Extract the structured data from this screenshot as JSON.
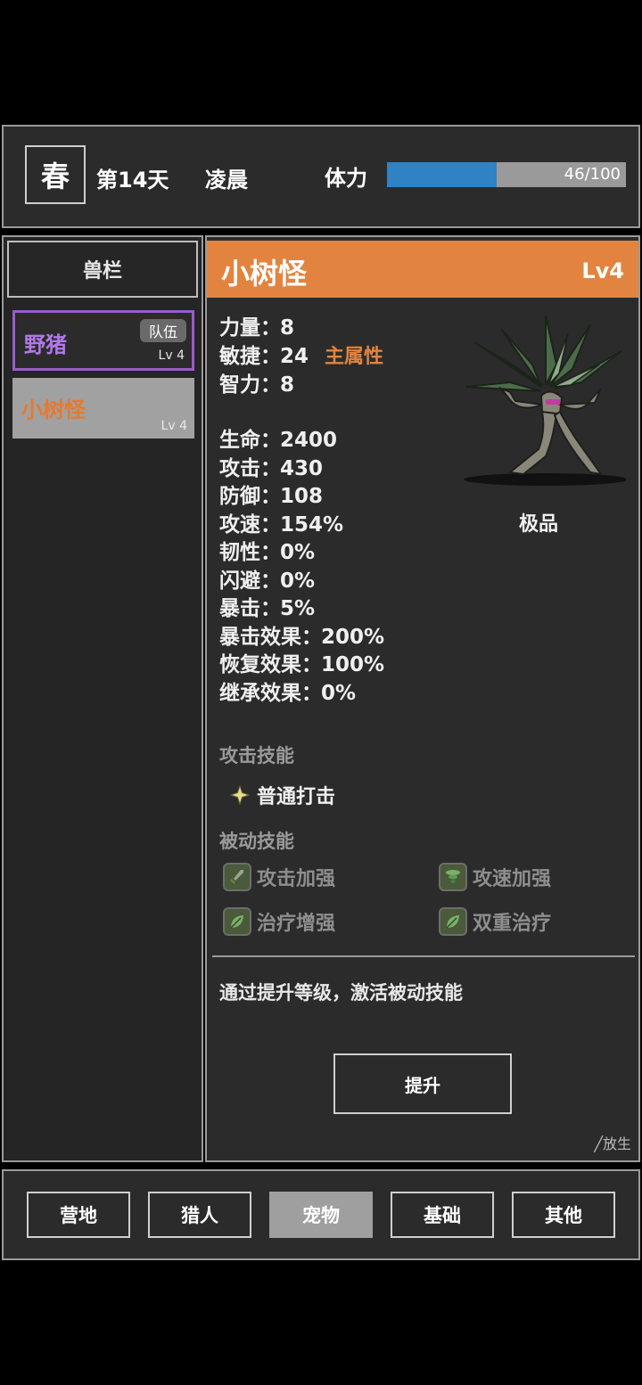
{
  "header": {
    "season": "春",
    "day": "第14天",
    "time_of_day": "凌晨",
    "stamina_label": "体力",
    "stamina_current": 46,
    "stamina_max": 100,
    "stamina_text": "46/100",
    "stamina_color": "#2f82c4"
  },
  "pet_list": {
    "title": "兽栏",
    "items": [
      {
        "name": "野猪",
        "level": "Lv 4",
        "badge": "队伍",
        "name_color": "#b078e8"
      },
      {
        "name": "小树怪",
        "level": "Lv 4",
        "name_color": "#e57a30"
      }
    ]
  },
  "detail": {
    "name": "小树怪",
    "level": "Lv4",
    "title_bar_color": "#e2843f",
    "quality": "极品",
    "base_stats": [
      {
        "label": "力量",
        "value": "8"
      },
      {
        "label": "敏捷",
        "value": "24",
        "note": "主属性"
      },
      {
        "label": "智力",
        "value": "8"
      }
    ],
    "combat_stats": [
      {
        "label": "生命",
        "value": "2400"
      },
      {
        "label": "攻击",
        "value": "430"
      },
      {
        "label": "防御",
        "value": "108"
      },
      {
        "label": "攻速",
        "value": "154%"
      },
      {
        "label": "韧性",
        "value": "0%"
      },
      {
        "label": "闪避",
        "value": "0%"
      },
      {
        "label": "暴击",
        "value": "5%"
      },
      {
        "label": "暴击效果",
        "value": "200%"
      },
      {
        "label": "恢复效果",
        "value": "100%"
      },
      {
        "label": "继承效果",
        "value": "0%"
      }
    ],
    "colon": "：",
    "attack_skill_title": "攻击技能",
    "attack_skill": "普通打击",
    "passive_skill_title": "被动技能",
    "passive_skills": [
      {
        "name": "攻击加强",
        "icon": "sword-icon"
      },
      {
        "name": "攻速加强",
        "icon": "whirlwind-icon"
      },
      {
        "name": "治疗增强",
        "icon": "leaf-heal-icon"
      },
      {
        "name": "双重治疗",
        "icon": "leaf-heal-icon"
      }
    ],
    "hint": "通过提升等级，激活被动技能",
    "upgrade_label": "提升",
    "release_label": "╱放生"
  },
  "bottom_nav": {
    "tabs": [
      "营地",
      "猎人",
      "宠物",
      "基础",
      "其他"
    ],
    "active_index": 2
  }
}
